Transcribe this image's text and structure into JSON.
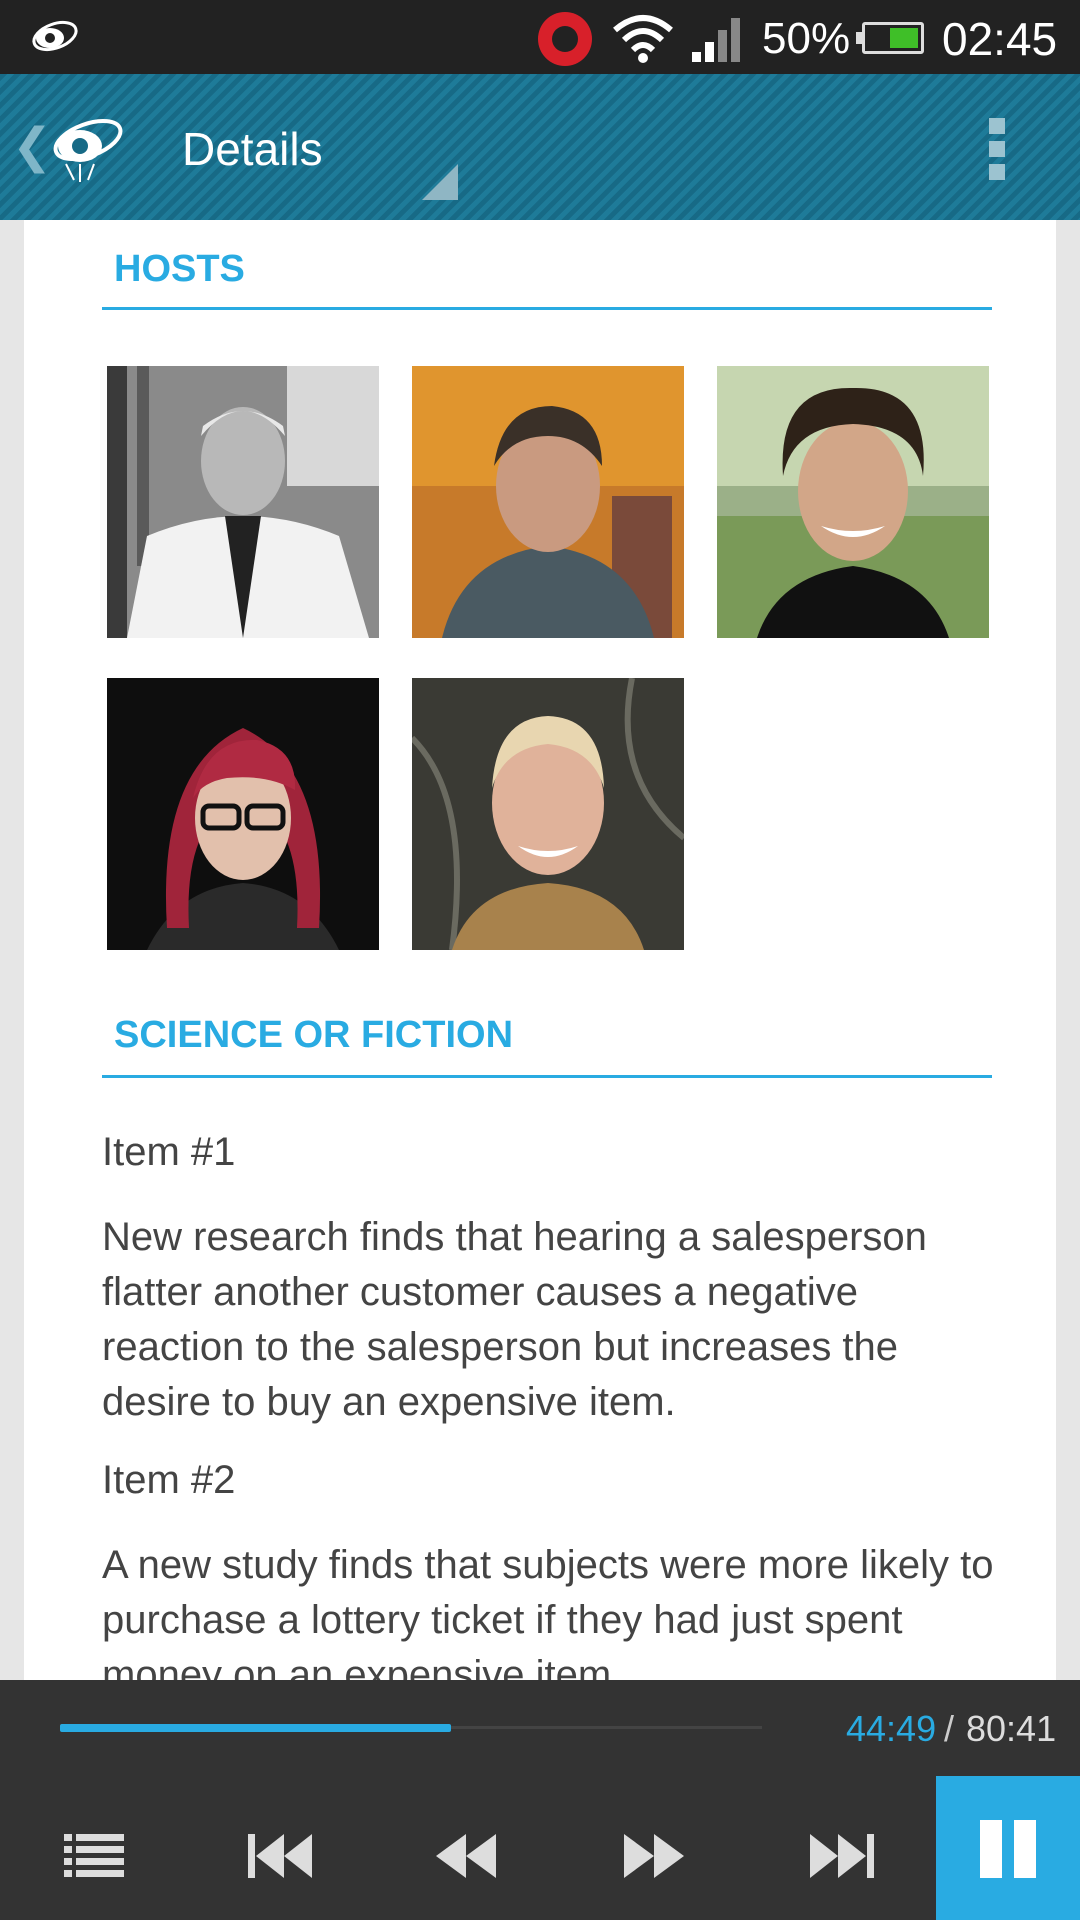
{
  "status_bar": {
    "battery_percent": "50%",
    "time": "02:45",
    "icons": [
      "app-logo-icon",
      "beats-icon",
      "wifi-icon",
      "signal-icon",
      "battery-icon"
    ]
  },
  "action_bar": {
    "title": "Details",
    "icons": [
      "back-chevron-icon",
      "app-logo-icon",
      "overflow-menu-icon"
    ]
  },
  "hosts": {
    "header": "HOSTS",
    "photos": [
      "host-photo",
      "host-photo",
      "host-photo",
      "host-photo",
      "host-photo"
    ]
  },
  "science_or_fiction": {
    "header": "SCIENCE OR FICTION",
    "items": [
      {
        "label": "Item #1",
        "text": "New research finds that hearing a salesperson flatter another customer causes a negative reaction to the salesperson but increases the desire to buy an expensive item."
      },
      {
        "label": "Item #2",
        "text": "A new study finds that subjects were more likely to purchase a lottery ticket if they had just spent money on an expensive item."
      }
    ]
  },
  "player": {
    "current_time": "44:49",
    "separator": "/",
    "total_time": "80:41",
    "progress_fraction": 0.5563,
    "accent_color": "#29abe2",
    "controls": [
      "playlist-icon",
      "skip-previous-icon",
      "rewind-icon",
      "fast-forward-icon",
      "skip-next-icon",
      "pause-icon"
    ]
  }
}
